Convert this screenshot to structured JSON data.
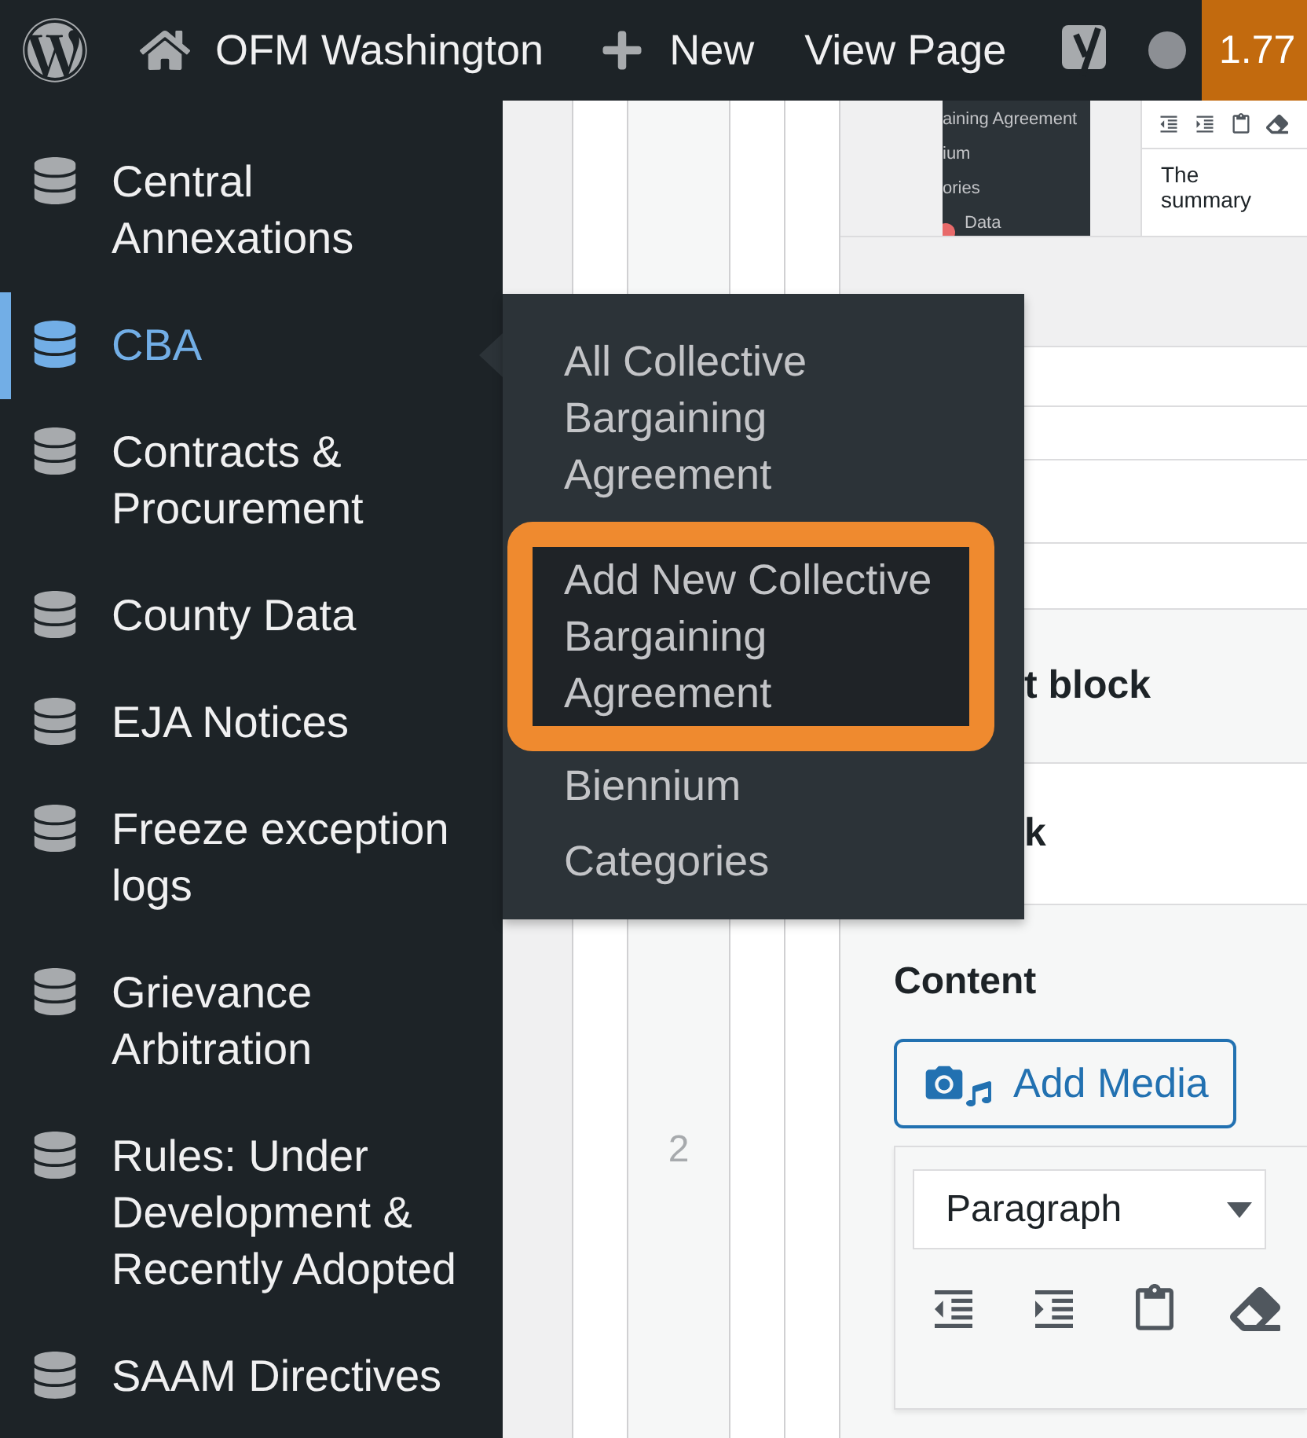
{
  "top_bar": {
    "site_name": "OFM Washington",
    "new_label": "New",
    "view_label": "View Page",
    "timing": "1.77"
  },
  "sidebar": {
    "items": [
      {
        "label": "Central Annexations",
        "selected": false
      },
      {
        "label": "CBA",
        "selected": true
      },
      {
        "label": "Contracts & Procurement",
        "selected": false
      },
      {
        "label": "County Data",
        "selected": false
      },
      {
        "label": "EJA Notices",
        "selected": false
      },
      {
        "label": "Freeze exception logs",
        "selected": false
      },
      {
        "label": "Grievance Arbitration",
        "selected": false
      },
      {
        "label": "Rules: Under Development & Recently Adopted",
        "selected": false
      },
      {
        "label": "SAAM Directives",
        "selected": false
      }
    ]
  },
  "flyout": {
    "items": [
      {
        "label": "All Collective Bargaining Agreement",
        "highlighted": false
      },
      {
        "label": "Add New Collective Bargaining Agreement",
        "highlighted": true
      },
      {
        "label": "Biennium",
        "highlighted": false
      },
      {
        "label": "Categories",
        "highlighted": false
      }
    ]
  },
  "thumbnail": {
    "menu_texts": [
      "aining Agreement",
      "ium",
      "ories",
      "Data"
    ],
    "editor_text": "The summary"
  },
  "rows": [
    {
      "text": "t block"
    },
    {
      "text": "k"
    }
  ],
  "row_number": "2",
  "content": {
    "label": "Content",
    "add_media": "Add Media",
    "format": "Paragraph"
  }
}
